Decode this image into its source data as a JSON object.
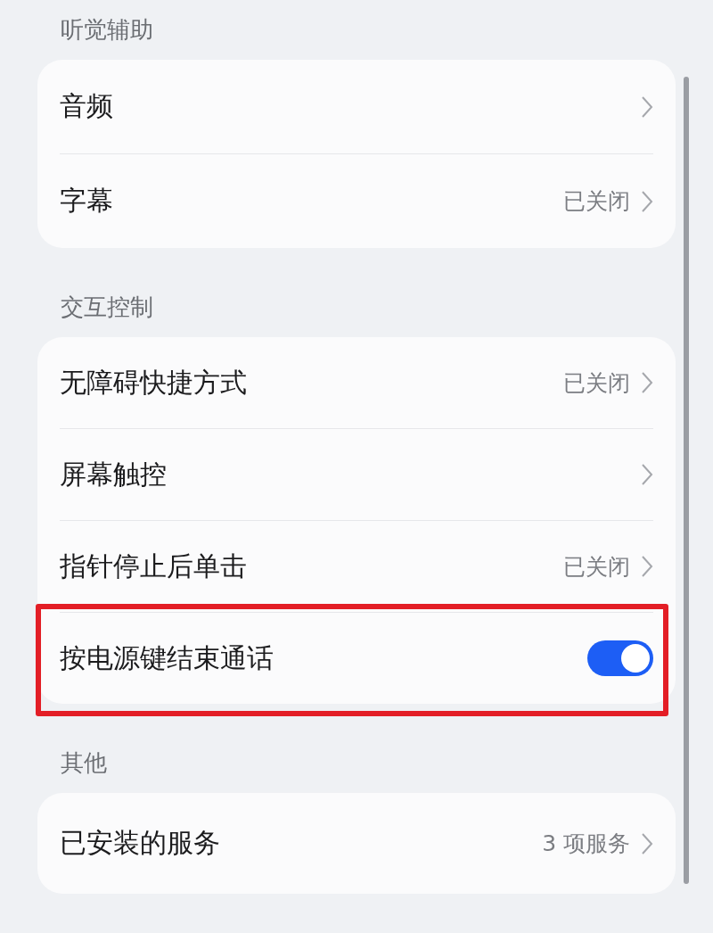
{
  "sections": [
    {
      "title": "听觉辅助",
      "items": [
        {
          "kind": "link",
          "label": "音频"
        },
        {
          "kind": "link",
          "label": "字幕",
          "value": "已关闭"
        }
      ]
    },
    {
      "title": "交互控制",
      "items": [
        {
          "kind": "link",
          "label": "无障碍快捷方式",
          "value": "已关闭"
        },
        {
          "kind": "link",
          "label": "屏幕触控"
        },
        {
          "kind": "link",
          "label": "指针停止后单击",
          "value": "已关闭"
        },
        {
          "kind": "toggle",
          "label": "按电源键结束通话",
          "on": true,
          "highlighted": true
        }
      ]
    },
    {
      "title": "其他",
      "items": [
        {
          "kind": "link",
          "label": "已安装的服务",
          "value": "3 项服务"
        }
      ]
    }
  ]
}
